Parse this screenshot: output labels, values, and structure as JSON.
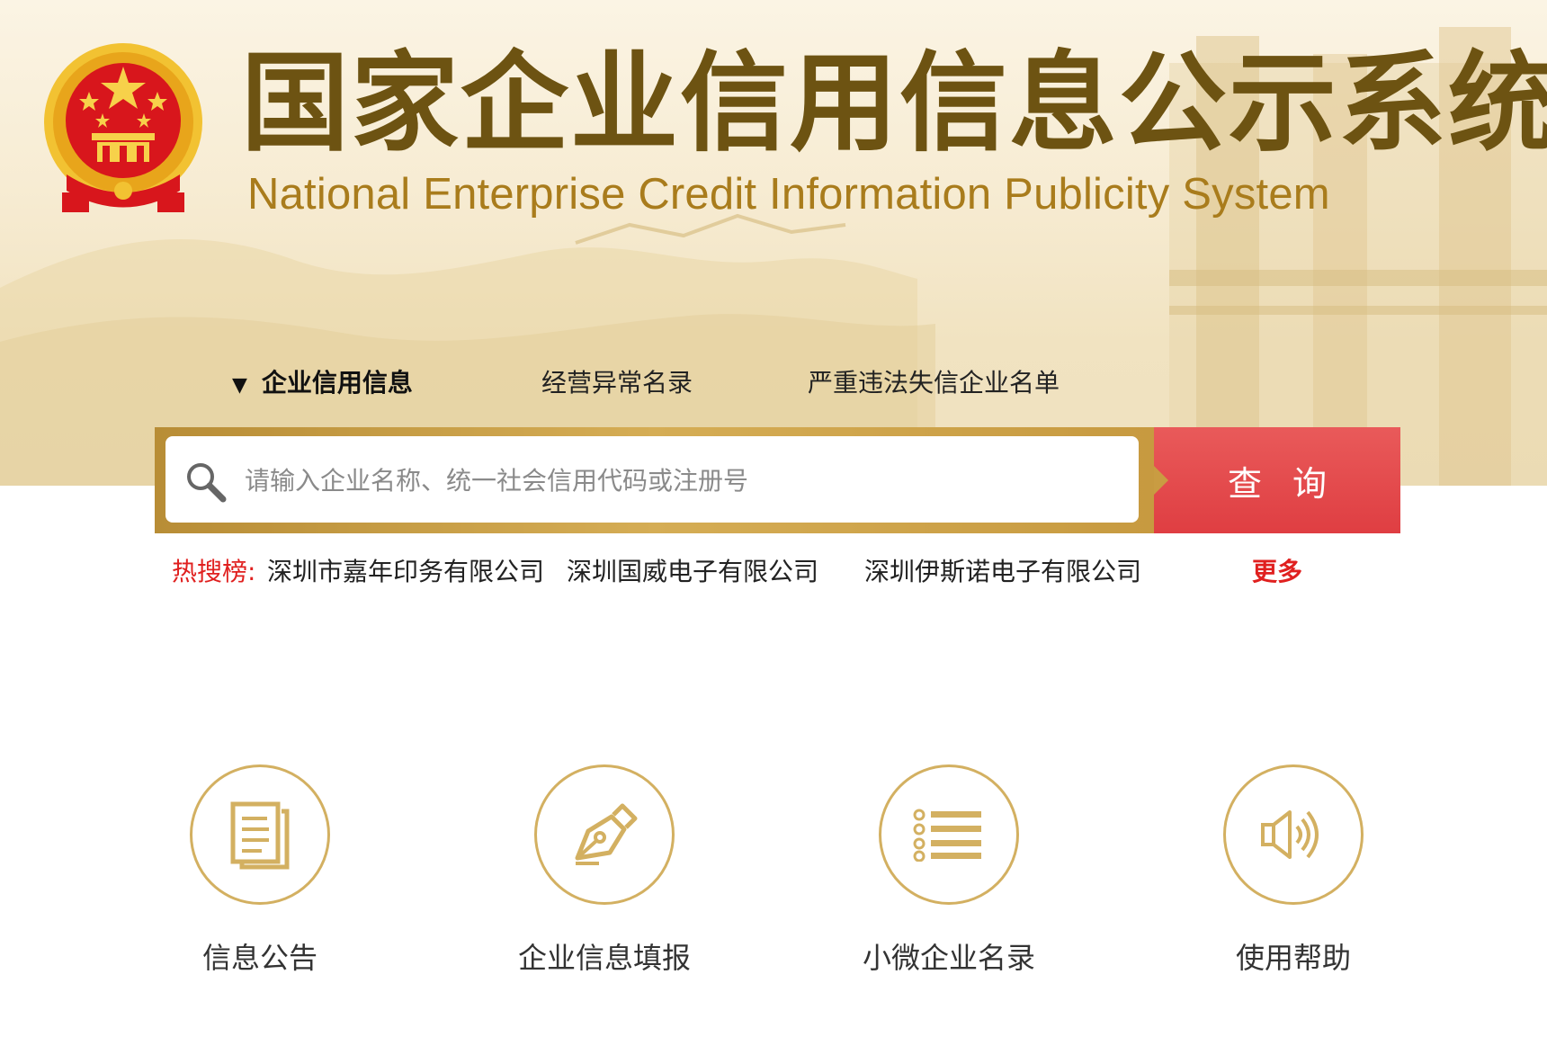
{
  "header": {
    "title_cn": "国家企业信用信息公示系统",
    "title_en": "National Enterprise Credit Information Publicity System",
    "emblem_icon": "national-emblem-icon"
  },
  "tabs": [
    {
      "label": "企业信用信息",
      "active": true
    },
    {
      "label": "经营异常名录",
      "active": false
    },
    {
      "label": "严重违法失信企业名单",
      "active": false
    }
  ],
  "search": {
    "placeholder": "请输入企业名称、统一社会信用代码或注册号",
    "button_label": "查询",
    "icon": "search-icon"
  },
  "hot_search": {
    "label": "热搜榜:",
    "items": [
      "深圳市嘉年印务有限公司",
      "深圳国威电子有限公司",
      "深圳伊斯诺电子有限公司"
    ],
    "more_label": "更多"
  },
  "features": [
    {
      "label": "信息公告",
      "icon": "document-icon"
    },
    {
      "label": "企业信息填报",
      "icon": "pen-nib-icon"
    },
    {
      "label": "小微企业名录",
      "icon": "list-icon"
    },
    {
      "label": "使用帮助",
      "icon": "speaker-icon"
    }
  ],
  "colors": {
    "brand_gold": "#d3b061",
    "title_brown": "#6d5312",
    "accent_red": "#e0201f",
    "button_red": "#e24a4c"
  }
}
